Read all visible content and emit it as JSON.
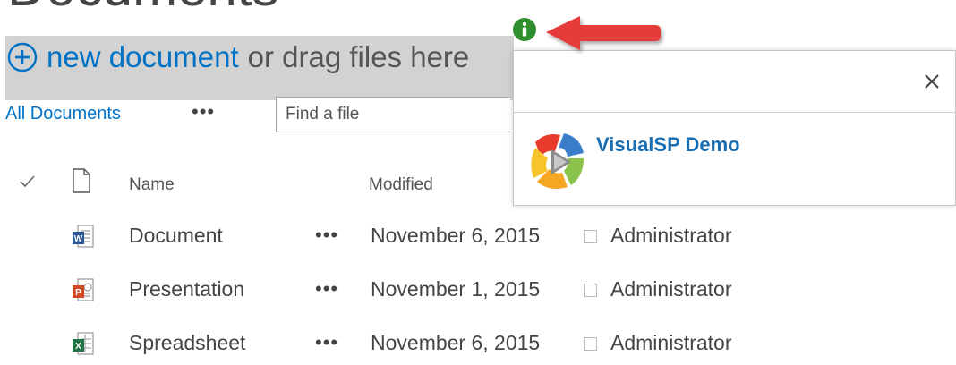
{
  "page": {
    "title": "Documents"
  },
  "toolbar": {
    "new_document_label": "new document",
    "drag_text": "or drag files here"
  },
  "views": {
    "current_view": "All Documents",
    "more_label": "•••"
  },
  "search": {
    "placeholder": "Find a file"
  },
  "columns": {
    "name": "Name",
    "modified": "Modified"
  },
  "files": [
    {
      "name": "Document",
      "type": "word",
      "menu": "•••",
      "modified": "November 6, 2015",
      "modified_by": "Administrator"
    },
    {
      "name": "Presentation",
      "type": "powerpoint",
      "menu": "•••",
      "modified": "November 1, 2015",
      "modified_by": "Administrator"
    },
    {
      "name": "Spreadsheet",
      "type": "excel",
      "menu": "•••",
      "modified": "November 6, 2015",
      "modified_by": "Administrator"
    }
  ],
  "callout": {
    "title": "VisualSP Demo",
    "close_glyph": "×"
  },
  "icons": {
    "info": "info-icon",
    "arrow": "red-arrow-icon",
    "plus": "plus-circle-icon",
    "logo": "visualsp-logo-icon"
  },
  "colors": {
    "accent": "#0072c6",
    "dropzone": "#d2d2d2",
    "info_green": "#2f8f2f",
    "arrow_red": "#e53b3b",
    "word": "#2b579a",
    "powerpoint": "#d24726",
    "excel": "#217346"
  }
}
